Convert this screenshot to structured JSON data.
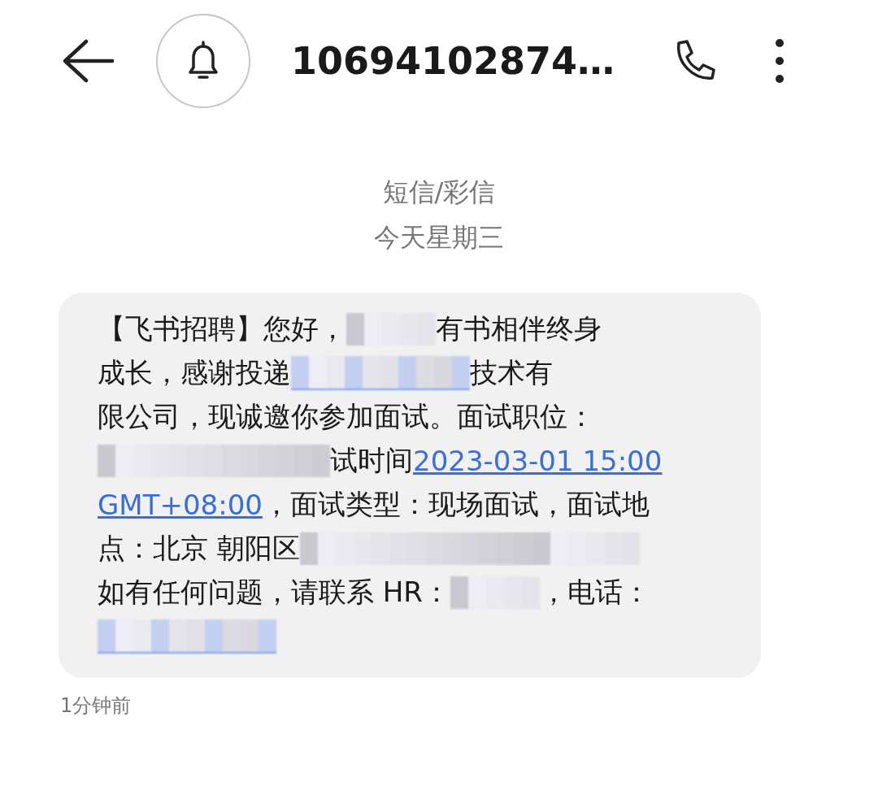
{
  "header": {
    "title": "10694102874…"
  },
  "thread": {
    "channel": "短信/彩信",
    "date": "今天星期三"
  },
  "message": {
    "lines": [
      [
        {
          "kind": "text",
          "text": "【飞书招聘】您好，"
        },
        {
          "kind": "mosaic-s"
        },
        {
          "kind": "text",
          "text": "有书相伴终身"
        }
      ],
      [
        {
          "kind": "text",
          "text": "成长，感谢投递"
        },
        {
          "kind": "linkmosaic-m"
        },
        {
          "kind": "text",
          "text": "技术有"
        }
      ],
      [
        {
          "kind": "text",
          "text": "限公司，现诚邀你参加面试。面试职位："
        }
      ],
      [
        {
          "kind": "mosaic-l"
        },
        {
          "kind": "text",
          "text": "试时间"
        },
        {
          "kind": "link",
          "text": "2023-03-01 15:00"
        }
      ],
      [
        {
          "kind": "link",
          "text": "GMT+08:00"
        },
        {
          "kind": "text",
          "text": "，面试类型：现场面试，面试地"
        }
      ],
      [
        {
          "kind": "text",
          "text": "点：北京 朝阳区"
        },
        {
          "kind": "mosaic-xl"
        }
      ],
      [
        {
          "kind": "text",
          "text": "如有任何问题，请联系 HR："
        },
        {
          "kind": "mosaic-s"
        },
        {
          "kind": "text",
          "text": "，电话："
        }
      ],
      [
        {
          "kind": "linkmosaic-m"
        }
      ]
    ],
    "time": "1分钟前"
  }
}
